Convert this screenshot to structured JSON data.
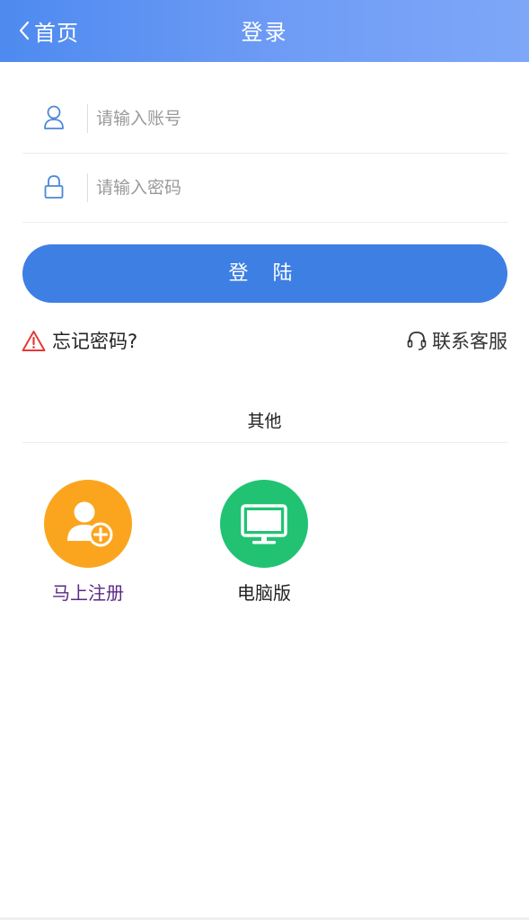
{
  "header": {
    "back_label": "首页",
    "title": "登录"
  },
  "form": {
    "account_placeholder": "请输入账号",
    "password_placeholder": "请输入密码",
    "login_label": "登 陆"
  },
  "links": {
    "forgot_label": "忘记密码?",
    "service_label": "联系客服"
  },
  "other": {
    "title": "其他",
    "register_label": "马上注册",
    "pc_label": "电脑版"
  },
  "icons": {
    "back": "chevron-left-icon",
    "account": "user-icon",
    "password": "lock-icon",
    "forgot": "warning-icon",
    "service": "headset-icon",
    "register": "user-add-icon",
    "pc": "monitor-icon"
  },
  "colors": {
    "header_start": "#4e8af0",
    "header_end": "#7ea7f8",
    "primary": "#3e7fe3",
    "warning": "#e53935",
    "register": "#fba51f",
    "pc": "#21c373",
    "register_text": "#5b2a86"
  }
}
